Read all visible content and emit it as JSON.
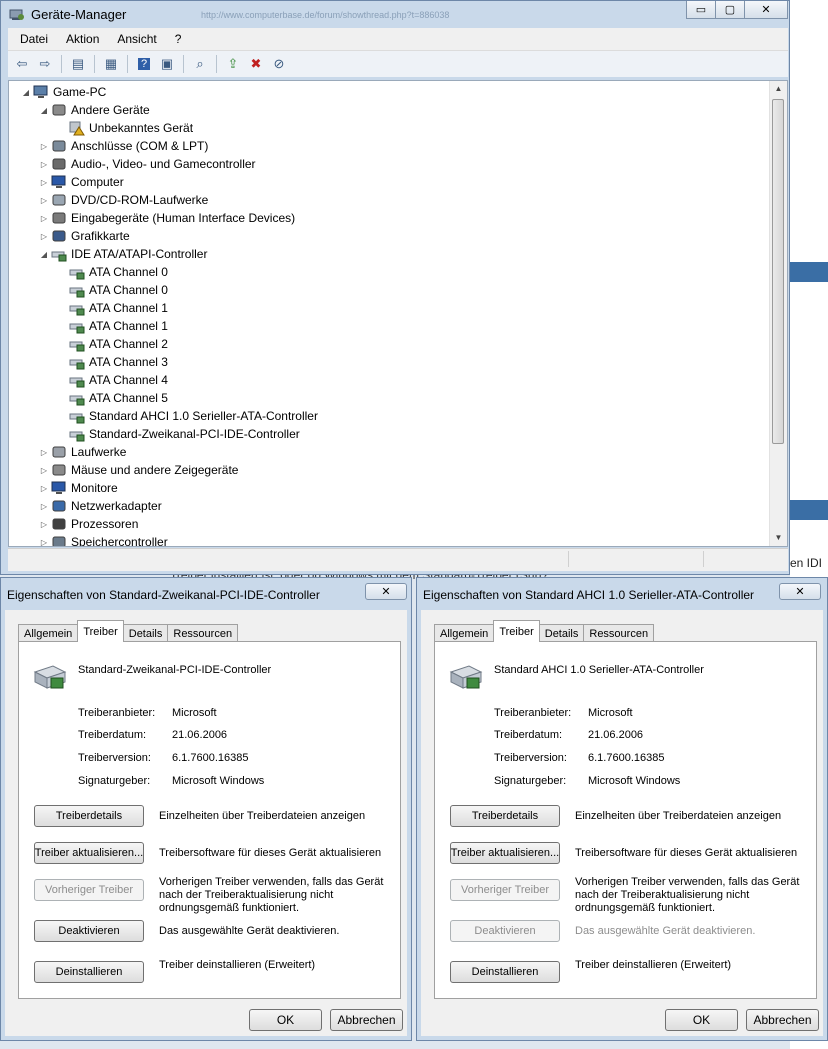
{
  "background": {
    "behind_text": "Treiber installiert ist, oder ob Windows mit dem Standard-Treiber (Surf?",
    "ie_text": "en IDI"
  },
  "device_manager": {
    "title": "Geräte-Manager",
    "blur_url": "http://www.computerbase.de/forum/showthread.php?t=886038",
    "caption_buttons": {
      "minimize": "▭",
      "maximize": "▢",
      "close": "✕"
    },
    "menu": [
      "Datei",
      "Aktion",
      "Ansicht",
      "?"
    ],
    "toolbar_icons": [
      "back-icon",
      "forward-icon",
      "show-hide-console-tree-icon",
      "properties-icon",
      "help-icon",
      "view-icon",
      "scan-hardware-icon",
      "update-driver-icon",
      "uninstall-icon",
      "disable-icon"
    ],
    "tree": [
      {
        "label": "Game-PC",
        "level": 0,
        "expander": "◢",
        "icon": "computer-icon"
      },
      {
        "label": "Andere Geräte",
        "level": 1,
        "expander": "◢",
        "icon": "unknown-device-icon"
      },
      {
        "label": "Unbekanntes Gerät",
        "level": 2,
        "expander": "",
        "icon": "warning-device-icon"
      },
      {
        "label": "Anschlüsse (COM & LPT)",
        "level": 1,
        "expander": "▷",
        "icon": "port-icon"
      },
      {
        "label": "Audio-, Video- und Gamecontroller",
        "level": 1,
        "expander": "▷",
        "icon": "speaker-icon"
      },
      {
        "label": "Computer",
        "level": 1,
        "expander": "▷",
        "icon": "monitor-icon"
      },
      {
        "label": "DVD/CD-ROM-Laufwerke",
        "level": 1,
        "expander": "▷",
        "icon": "disc-icon"
      },
      {
        "label": "Eingabegeräte (Human Interface Devices)",
        "level": 1,
        "expander": "▷",
        "icon": "hid-icon"
      },
      {
        "label": "Grafikkarte",
        "level": 1,
        "expander": "▷",
        "icon": "display-adapter-icon"
      },
      {
        "label": "IDE ATA/ATAPI-Controller",
        "level": 1,
        "expander": "◢",
        "icon": "ide-controller-icon"
      },
      {
        "label": "ATA Channel 0",
        "level": 2,
        "expander": "",
        "icon": "ide-controller-icon"
      },
      {
        "label": "ATA Channel 0",
        "level": 2,
        "expander": "",
        "icon": "ide-controller-icon"
      },
      {
        "label": "ATA Channel 1",
        "level": 2,
        "expander": "",
        "icon": "ide-controller-icon"
      },
      {
        "label": "ATA Channel 1",
        "level": 2,
        "expander": "",
        "icon": "ide-controller-icon"
      },
      {
        "label": "ATA Channel 2",
        "level": 2,
        "expander": "",
        "icon": "ide-controller-icon"
      },
      {
        "label": "ATA Channel 3",
        "level": 2,
        "expander": "",
        "icon": "ide-controller-icon"
      },
      {
        "label": "ATA Channel 4",
        "level": 2,
        "expander": "",
        "icon": "ide-controller-icon"
      },
      {
        "label": "ATA Channel 5",
        "level": 2,
        "expander": "",
        "icon": "ide-controller-icon"
      },
      {
        "label": "Standard AHCI 1.0 Serieller-ATA-Controller",
        "level": 2,
        "expander": "",
        "icon": "ide-controller-icon"
      },
      {
        "label": "Standard-Zweikanal-PCI-IDE-Controller",
        "level": 2,
        "expander": "",
        "icon": "ide-controller-icon"
      },
      {
        "label": "Laufwerke",
        "level": 1,
        "expander": "▷",
        "icon": "drive-icon"
      },
      {
        "label": "Mäuse und andere Zeigegeräte",
        "level": 1,
        "expander": "▷",
        "icon": "mouse-icon"
      },
      {
        "label": "Monitore",
        "level": 1,
        "expander": "▷",
        "icon": "monitor-icon"
      },
      {
        "label": "Netzwerkadapter",
        "level": 1,
        "expander": "▷",
        "icon": "network-icon"
      },
      {
        "label": "Prozessoren",
        "level": 1,
        "expander": "▷",
        "icon": "processor-icon"
      },
      {
        "label": "Speichercontroller",
        "level": 1,
        "expander": "▷",
        "icon": "storage-controller-icon"
      }
    ]
  },
  "dialog_left": {
    "title": "Eigenschaften von Standard-Zweikanal-PCI-IDE-Controller",
    "close": "✕",
    "tabs": [
      "Allgemein",
      "Treiber",
      "Details",
      "Ressourcen"
    ],
    "active_tab": 1,
    "device_name": "Standard-Zweikanal-PCI-IDE-Controller",
    "info": [
      {
        "key": "Treiberanbieter:",
        "value": "Microsoft"
      },
      {
        "key": "Treiberdatum:",
        "value": "21.06.2006"
      },
      {
        "key": "Treiberversion:",
        "value": "6.1.7600.16385"
      },
      {
        "key": "Signaturgeber:",
        "value": "Microsoft Windows"
      }
    ],
    "actions": [
      {
        "button": "Treiberdetails",
        "desc": "Einzelheiten über Treiberdateien anzeigen",
        "enabled": true
      },
      {
        "button": "Treiber aktualisieren...",
        "desc": "Treibersoftware für dieses Gerät aktualisieren",
        "enabled": true
      },
      {
        "button": "Vorheriger Treiber",
        "desc": "Vorherigen Treiber verwenden, falls das Gerät nach der Treiberaktualisierung nicht ordnungsgemäß funktioniert.",
        "enabled": false
      },
      {
        "button": "Deaktivieren",
        "desc": "Das ausgewählte Gerät deaktivieren.",
        "enabled": true
      },
      {
        "button": "Deinstallieren",
        "desc": "Treiber deinstallieren (Erweitert)",
        "enabled": true
      }
    ],
    "ok": "OK",
    "cancel": "Abbrechen"
  },
  "dialog_right": {
    "title": "Eigenschaften von Standard AHCI 1.0 Serieller-ATA-Controller",
    "close": "✕",
    "tabs": [
      "Allgemein",
      "Treiber",
      "Details",
      "Ressourcen"
    ],
    "active_tab": 1,
    "device_name": "Standard AHCI 1.0 Serieller-ATA-Controller",
    "info": [
      {
        "key": "Treiberanbieter:",
        "value": "Microsoft"
      },
      {
        "key": "Treiberdatum:",
        "value": "21.06.2006"
      },
      {
        "key": "Treiberversion:",
        "value": "6.1.7600.16385"
      },
      {
        "key": "Signaturgeber:",
        "value": "Microsoft Windows"
      }
    ],
    "actions": [
      {
        "button": "Treiberdetails",
        "desc": "Einzelheiten über Treiberdateien anzeigen",
        "enabled": true
      },
      {
        "button": "Treiber aktualisieren...",
        "desc": "Treibersoftware für dieses Gerät aktualisieren",
        "enabled": true
      },
      {
        "button": "Vorheriger Treiber",
        "desc": "Vorherigen Treiber verwenden, falls das Gerät nach der Treiberaktualisierung nicht ordnungsgemäß funktioniert.",
        "enabled": false
      },
      {
        "button": "Deaktivieren",
        "desc": "Das ausgewählte Gerät deaktivieren.",
        "enabled": false
      },
      {
        "button": "Deinstallieren",
        "desc": "Treiber deinstallieren (Erweitert)",
        "enabled": true
      }
    ],
    "ok": "OK",
    "cancel": "Abbrechen"
  }
}
